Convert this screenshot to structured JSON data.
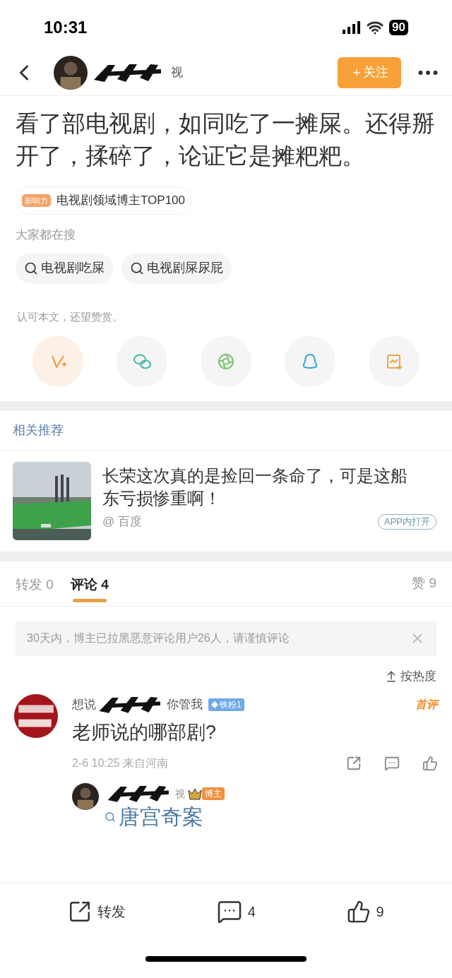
{
  "status_bar": {
    "time": "10:31",
    "battery": "90"
  },
  "header": {
    "author_visible": "视",
    "follow_button": "＋关注"
  },
  "post": {
    "text": "看了部电视剧，如同吃了一摊屎。还得掰开了，揉碎了，论证它是摊粑粑。",
    "badge_tag": "影响力",
    "badge_text": "电视剧领域博主TOP100"
  },
  "searches": {
    "title": "大家都在搜",
    "items": [
      "电视剧吃屎",
      "电视剧屎尿屁"
    ]
  },
  "reward_tip": "认可本文，还望赞赏。",
  "share_buttons": [
    {
      "kind": "reward"
    },
    {
      "kind": "wechat"
    },
    {
      "kind": "moments"
    },
    {
      "kind": "qq"
    },
    {
      "kind": "save"
    }
  ],
  "related": {
    "title": "相关推荐",
    "card": {
      "headline": "长荣这次真的是捡回一条命了，可是这船东亏损惨重啊！",
      "source": "@ 百度",
      "open_button": "APP内打开"
    }
  },
  "tabs": [
    {
      "label": "转发",
      "count": "0",
      "selected": false
    },
    {
      "label": "评论",
      "count": "4",
      "selected": true
    }
  ],
  "likes": {
    "label": "赞",
    "count": "9"
  },
  "notice": "30天内，博主已拉黑恶意评论用户26人，请谨慎评论",
  "sort": "按热度",
  "comments": [
    {
      "name_start": "想说",
      "name_end": "你管我",
      "fan_badge": "铁粉1",
      "first_tag": "首评",
      "text": "老师说的哪部剧?",
      "meta": "2-6 10:25 来自河南",
      "reply": {
        "name_end": "视",
        "author_badge": "博主",
        "text": "唐宫奇案"
      }
    }
  ],
  "bottom_bar": [
    {
      "kind": "repost",
      "label": "转发"
    },
    {
      "kind": "comment",
      "label": "4"
    },
    {
      "kind": "like",
      "label": "9"
    }
  ]
}
